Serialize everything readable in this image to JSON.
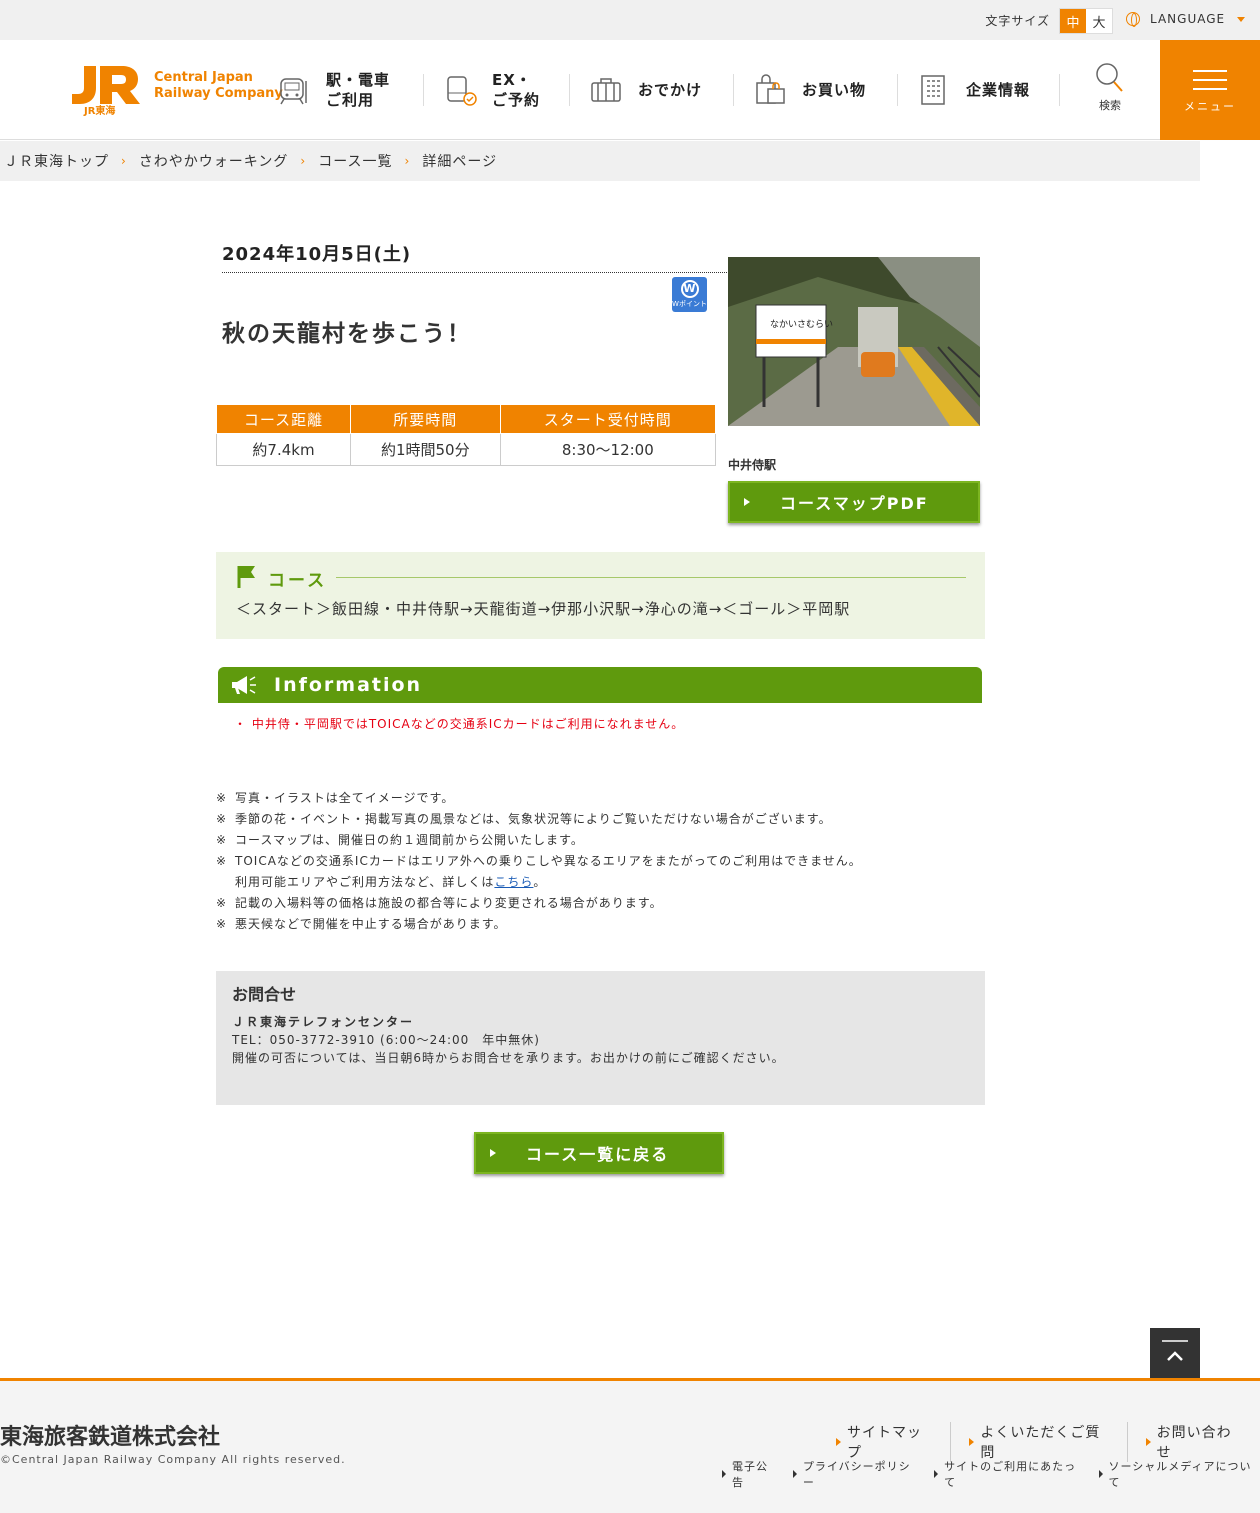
{
  "top_bar": {
    "font_size_label": "文字サイズ",
    "font_size_options": [
      "中",
      "大"
    ],
    "font_size_selected": "中",
    "language_label": "LANGUAGE"
  },
  "header": {
    "logo_mark": "JR東海",
    "logo_line1": "Central Japan",
    "logo_line2": "Railway Company",
    "nav": [
      {
        "label": "駅・電車\nご利用",
        "icon": "train-icon"
      },
      {
        "label": "EX・\nご予約",
        "icon": "ticket-check-icon"
      },
      {
        "label": "おでかけ",
        "icon": "suitcase-icon"
      },
      {
        "label": "お買い物",
        "icon": "shopping-bag-icon"
      },
      {
        "label": "企業情報",
        "icon": "building-icon"
      }
    ],
    "search_label": "検索",
    "menu_label": "メニュー"
  },
  "breadcrumb": [
    "ＪＲ東海トップ",
    "さわやかウォーキング",
    "コース一覧",
    "詳細ページ"
  ],
  "event": {
    "date": "2024年10月5日(土)",
    "title": "秋の天龍村を歩こう！",
    "badge_letter": "W",
    "badge_text": "Wポイント",
    "photo_caption": "中井侍駅",
    "photo_sign_text": "なかいさむらい",
    "pdf_button": "コースマップPDF",
    "table_headers": [
      "コース距離",
      "所要時間",
      "スタート受付時間"
    ],
    "table_values": [
      "約7.4km",
      "約1時間50分",
      "8:30〜12:00"
    ]
  },
  "course": {
    "heading": "コース",
    "route": "＜スタート＞飯田線・中井侍駅→天龍街道→伊那小沢駅→浄心の滝→＜ゴール＞平岡駅"
  },
  "information": {
    "heading": "Information",
    "note": "中井侍・平岡駅ではTOICAなどの交通系ICカードはご利用になれません。"
  },
  "notes": {
    "mark": "※",
    "items": [
      "写真・イラストは全てイメージです。",
      "季節の花・イベント・掲載写真の風景などは、気象状況等によりご覧いただけない場合がございます。",
      "コースマップは、開催日の約１週間前から公開いたします。",
      "TOICAなどの交通系ICカードはエリア外への乗りこしや異なるエリアをまたがってのご利用はできません。"
    ],
    "toica_line2_before": "利用可能エリアやご利用方法など、詳しくは",
    "toica_link": "こちら",
    "toica_line2_after": "。",
    "items2": [
      "記載の入場料等の価格は施設の都合等により変更される場合があります。",
      "悪天候などで開催を中止する場合があります。"
    ]
  },
  "contact": {
    "heading": "お問合せ",
    "name": "ＪＲ東海テレフォンセンター",
    "tel": "TEL：050-3772-3910 (6:00〜24:00　年中無休)",
    "text": "開催の可否については、当日朝6時からお問合せを承ります。お出かけの前にご確認ください。"
  },
  "back_button": "コース一覧に戻る",
  "footer": {
    "corp_name": "東海旅客鉄道株式会社",
    "copyright": "©Central Japan Railway Company All rights reserved.",
    "links_main": [
      "サイトマップ",
      "よくいただくご質問",
      "お問い合わせ"
    ],
    "links_sub": [
      "電子公告",
      "プライバシーポリシー",
      "サイトのご利用にあたって",
      "ソーシャルメディアについて"
    ]
  },
  "colors": {
    "brand_orange": "#f08300",
    "green": "#5f9a0d",
    "alert_red": "#e60012"
  }
}
